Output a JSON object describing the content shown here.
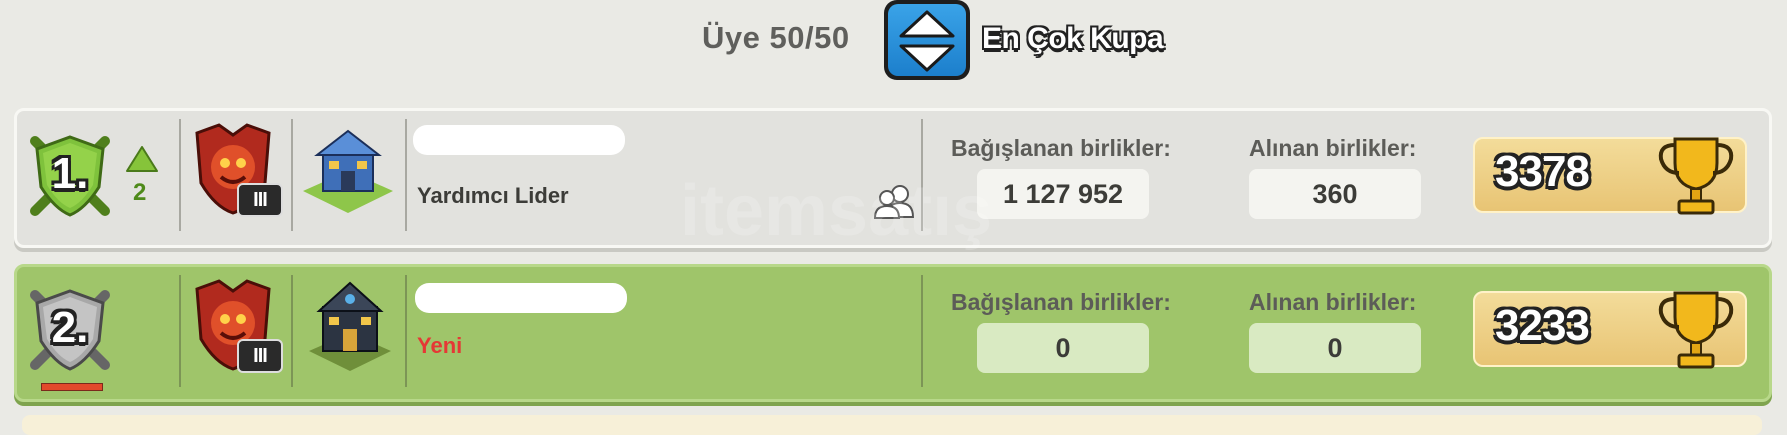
{
  "header": {
    "member_count": "Üye 50/50",
    "sort_button_icon": "sort-up-down-icon",
    "sort_label": "En Çok Kupa"
  },
  "members": [
    {
      "rank": "1.",
      "rank_change": "2",
      "rank_change_direction": "up",
      "league_tier": "III",
      "role": "Yardımcı Lider",
      "role_color": "#3c3c38",
      "donated_label": "Bağışlanan birlikler:",
      "donated": "1 127 952",
      "received_label": "Alınan birlikler:",
      "received": "360",
      "trophies": "3378",
      "friend_icon": true
    },
    {
      "rank": "2.",
      "league_tier": "III",
      "role": "Yeni",
      "role_color": "#e53935",
      "donated_label": "Bağışlanan birlikler:",
      "donated": "0",
      "received_label": "Alınan birlikler:",
      "received": "0",
      "trophies": "3233",
      "friend_icon": false
    }
  ],
  "colors": {
    "row_default": "#e2e2de",
    "row_self": "#9fc56a",
    "trophy_box": "#ecc97c",
    "sort_button": "#2b8fdc"
  }
}
